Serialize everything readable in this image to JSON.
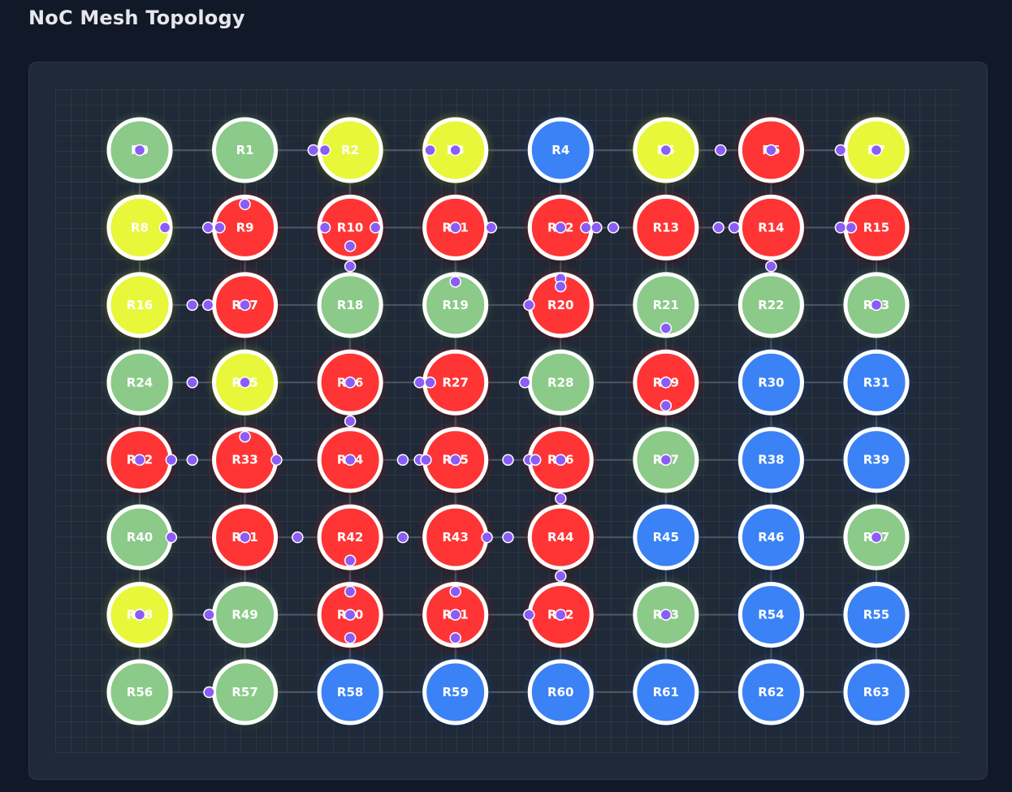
{
  "title": "NoC Mesh Topology",
  "grid": {
    "cols": 8,
    "rows": 8
  },
  "colors": {
    "green": "#8bca88",
    "yellow": "#e9f73a",
    "red": "#ff3434",
    "blue": "#3b82f6",
    "packet": "#8b5cf6",
    "link": "#4b5563",
    "node_border": "#ffffff"
  },
  "nodes": [
    {
      "label": "R0",
      "status": "green"
    },
    {
      "label": "R1",
      "status": "green"
    },
    {
      "label": "R2",
      "status": "yellow"
    },
    {
      "label": "R3",
      "status": "yellow"
    },
    {
      "label": "R4",
      "status": "blue"
    },
    {
      "label": "R5",
      "status": "yellow"
    },
    {
      "label": "R6",
      "status": "red"
    },
    {
      "label": "R7",
      "status": "yellow"
    },
    {
      "label": "R8",
      "status": "yellow"
    },
    {
      "label": "R9",
      "status": "red"
    },
    {
      "label": "R10",
      "status": "red"
    },
    {
      "label": "R11",
      "status": "red"
    },
    {
      "label": "R12",
      "status": "red"
    },
    {
      "label": "R13",
      "status": "red"
    },
    {
      "label": "R14",
      "status": "red"
    },
    {
      "label": "R15",
      "status": "red"
    },
    {
      "label": "R16",
      "status": "yellow"
    },
    {
      "label": "R17",
      "status": "red"
    },
    {
      "label": "R18",
      "status": "green"
    },
    {
      "label": "R19",
      "status": "green"
    },
    {
      "label": "R20",
      "status": "red"
    },
    {
      "label": "R21",
      "status": "green"
    },
    {
      "label": "R22",
      "status": "green"
    },
    {
      "label": "R23",
      "status": "green"
    },
    {
      "label": "R24",
      "status": "green"
    },
    {
      "label": "R25",
      "status": "yellow"
    },
    {
      "label": "R26",
      "status": "red"
    },
    {
      "label": "R27",
      "status": "red"
    },
    {
      "label": "R28",
      "status": "green"
    },
    {
      "label": "R29",
      "status": "red"
    },
    {
      "label": "R30",
      "status": "blue"
    },
    {
      "label": "R31",
      "status": "blue"
    },
    {
      "label": "R32",
      "status": "red"
    },
    {
      "label": "R33",
      "status": "red"
    },
    {
      "label": "R34",
      "status": "red"
    },
    {
      "label": "R35",
      "status": "red"
    },
    {
      "label": "R36",
      "status": "red"
    },
    {
      "label": "R37",
      "status": "green"
    },
    {
      "label": "R38",
      "status": "blue"
    },
    {
      "label": "R39",
      "status": "blue"
    },
    {
      "label": "R40",
      "status": "green"
    },
    {
      "label": "R41",
      "status": "red"
    },
    {
      "label": "R42",
      "status": "red"
    },
    {
      "label": "R43",
      "status": "red"
    },
    {
      "label": "R44",
      "status": "red"
    },
    {
      "label": "R45",
      "status": "blue"
    },
    {
      "label": "R46",
      "status": "blue"
    },
    {
      "label": "R47",
      "status": "green"
    },
    {
      "label": "R48",
      "status": "yellow"
    },
    {
      "label": "R49",
      "status": "green"
    },
    {
      "label": "R50",
      "status": "red"
    },
    {
      "label": "R51",
      "status": "red"
    },
    {
      "label": "R52",
      "status": "red"
    },
    {
      "label": "R53",
      "status": "green"
    },
    {
      "label": "R54",
      "status": "blue"
    },
    {
      "label": "R55",
      "status": "blue"
    },
    {
      "label": "R56",
      "status": "green"
    },
    {
      "label": "R57",
      "status": "green"
    },
    {
      "label": "R58",
      "status": "blue"
    },
    {
      "label": "R59",
      "status": "blue"
    },
    {
      "label": "R60",
      "status": "blue"
    },
    {
      "label": "R61",
      "status": "blue"
    },
    {
      "label": "R62",
      "status": "blue"
    },
    {
      "label": "R63",
      "status": "blue"
    }
  ],
  "packets": [
    {
      "link": "h",
      "row": 0,
      "col": 0,
      "t": 0.0
    },
    {
      "link": "h",
      "row": 0,
      "col": 1,
      "t": 0.65
    },
    {
      "link": "h",
      "row": 0,
      "col": 1,
      "t": 0.76
    },
    {
      "link": "h",
      "row": 0,
      "col": 2,
      "t": 0.76
    },
    {
      "link": "h",
      "row": 0,
      "col": 2,
      "t": 1.0
    },
    {
      "link": "h",
      "row": 0,
      "col": 5,
      "t": 0.0
    },
    {
      "link": "h",
      "row": 0,
      "col": 5,
      "t": 0.52
    },
    {
      "link": "h",
      "row": 0,
      "col": 5,
      "t": 1.0
    },
    {
      "link": "h",
      "row": 0,
      "col": 6,
      "t": 0.66
    },
    {
      "link": "h",
      "row": 0,
      "col": 6,
      "t": 1.0
    },
    {
      "link": "h",
      "row": 1,
      "col": 0,
      "t": 0.24
    },
    {
      "link": "h",
      "row": 1,
      "col": 0,
      "t": 0.65
    },
    {
      "link": "h",
      "row": 1,
      "col": 0,
      "t": 0.76
    },
    {
      "link": "h",
      "row": 1,
      "col": 1,
      "t": 0.76
    },
    {
      "link": "h",
      "row": 1,
      "col": 2,
      "t": 0.24
    },
    {
      "link": "h",
      "row": 1,
      "col": 2,
      "t": 1.0
    },
    {
      "link": "h",
      "row": 1,
      "col": 3,
      "t": 0.34
    },
    {
      "link": "h",
      "row": 1,
      "col": 3,
      "t": 1.0
    },
    {
      "link": "h",
      "row": 1,
      "col": 4,
      "t": 0.24
    },
    {
      "link": "h",
      "row": 1,
      "col": 4,
      "t": 0.34
    },
    {
      "link": "h",
      "row": 1,
      "col": 4,
      "t": 0.5
    },
    {
      "link": "h",
      "row": 1,
      "col": 5,
      "t": 0.5
    },
    {
      "link": "h",
      "row": 1,
      "col": 5,
      "t": 0.65
    },
    {
      "link": "h",
      "row": 1,
      "col": 6,
      "t": 0.66
    },
    {
      "link": "h",
      "row": 1,
      "col": 6,
      "t": 0.76
    },
    {
      "link": "h",
      "row": 2,
      "col": 0,
      "t": 0.5
    },
    {
      "link": "h",
      "row": 2,
      "col": 0,
      "t": 0.65
    },
    {
      "link": "h",
      "row": 2,
      "col": 1,
      "t": 0.0
    },
    {
      "link": "h",
      "row": 2,
      "col": 3,
      "t": 0.7
    },
    {
      "link": "h",
      "row": 2,
      "col": 6,
      "t": 1.0
    },
    {
      "link": "h",
      "row": 3,
      "col": 0,
      "t": 0.5
    },
    {
      "link": "h",
      "row": 3,
      "col": 1,
      "t": 0.0
    },
    {
      "link": "h",
      "row": 3,
      "col": 2,
      "t": 0.0
    },
    {
      "link": "h",
      "row": 3,
      "col": 2,
      "t": 0.66
    },
    {
      "link": "h",
      "row": 3,
      "col": 2,
      "t": 0.76
    },
    {
      "link": "h",
      "row": 3,
      "col": 3,
      "t": 0.66
    },
    {
      "link": "h",
      "row": 3,
      "col": 5,
      "t": 0.0
    },
    {
      "link": "h",
      "row": 4,
      "col": 0,
      "t": 0.0
    },
    {
      "link": "h",
      "row": 4,
      "col": 0,
      "t": 0.3
    },
    {
      "link": "h",
      "row": 4,
      "col": 0,
      "t": 0.5
    },
    {
      "link": "h",
      "row": 4,
      "col": 1,
      "t": 0.3
    },
    {
      "link": "h",
      "row": 4,
      "col": 2,
      "t": 0.0
    },
    {
      "link": "h",
      "row": 4,
      "col": 2,
      "t": 0.5
    },
    {
      "link": "h",
      "row": 4,
      "col": 2,
      "t": 0.66
    },
    {
      "link": "h",
      "row": 4,
      "col": 2,
      "t": 0.72
    },
    {
      "link": "h",
      "row": 4,
      "col": 3,
      "t": 0.0
    },
    {
      "link": "h",
      "row": 4,
      "col": 3,
      "t": 0.5
    },
    {
      "link": "h",
      "row": 4,
      "col": 3,
      "t": 0.7
    },
    {
      "link": "h",
      "row": 4,
      "col": 3,
      "t": 0.76
    },
    {
      "link": "h",
      "row": 4,
      "col": 4,
      "t": 0.0
    },
    {
      "link": "h",
      "row": 4,
      "col": 5,
      "t": 0.0
    },
    {
      "link": "h",
      "row": 5,
      "col": 0,
      "t": 0.3
    },
    {
      "link": "h",
      "row": 5,
      "col": 1,
      "t": 0.0
    },
    {
      "link": "h",
      "row": 5,
      "col": 1,
      "t": 0.5
    },
    {
      "link": "h",
      "row": 5,
      "col": 2,
      "t": 0.5
    },
    {
      "link": "h",
      "row": 5,
      "col": 3,
      "t": 0.3
    },
    {
      "link": "h",
      "row": 5,
      "col": 3,
      "t": 0.5
    },
    {
      "link": "h",
      "row": 5,
      "col": 7,
      "t": 0.0
    },
    {
      "link": "h",
      "row": 6,
      "col": 0,
      "t": 0.0
    },
    {
      "link": "h",
      "row": 6,
      "col": 0,
      "t": 0.66
    },
    {
      "link": "h",
      "row": 6,
      "col": 2,
      "t": 0.0
    },
    {
      "link": "h",
      "row": 6,
      "col": 3,
      "t": 0.0
    },
    {
      "link": "h",
      "row": 6,
      "col": 3,
      "t": 0.7
    },
    {
      "link": "h",
      "row": 6,
      "col": 5,
      "t": 0.0
    },
    {
      "link": "h",
      "row": 7,
      "col": 0,
      "t": 0.66
    },
    {
      "link": "v",
      "row": 0,
      "col": 1,
      "t": 0.7
    },
    {
      "link": "v",
      "row": 1,
      "col": 2,
      "t": 0.24
    },
    {
      "link": "v",
      "row": 1,
      "col": 2,
      "t": 0.5
    },
    {
      "link": "v",
      "row": 1,
      "col": 3,
      "t": 0.7
    },
    {
      "link": "v",
      "row": 1,
      "col": 4,
      "t": 0.66
    },
    {
      "link": "v",
      "row": 1,
      "col": 4,
      "t": 0.76
    },
    {
      "link": "v",
      "row": 1,
      "col": 6,
      "t": 0.5
    },
    {
      "link": "v",
      "row": 2,
      "col": 5,
      "t": 0.3
    },
    {
      "link": "v",
      "row": 3,
      "col": 2,
      "t": 0.5
    },
    {
      "link": "v",
      "row": 3,
      "col": 1,
      "t": 0.7
    },
    {
      "link": "v",
      "row": 3,
      "col": 5,
      "t": 0.3
    },
    {
      "link": "v",
      "row": 4,
      "col": 4,
      "t": 0.5
    },
    {
      "link": "v",
      "row": 5,
      "col": 2,
      "t": 0.3
    },
    {
      "link": "v",
      "row": 5,
      "col": 2,
      "t": 0.7
    },
    {
      "link": "v",
      "row": 5,
      "col": 4,
      "t": 0.5
    },
    {
      "link": "v",
      "row": 5,
      "col": 3,
      "t": 0.7
    },
    {
      "link": "v",
      "row": 6,
      "col": 2,
      "t": 0.3
    },
    {
      "link": "v",
      "row": 6,
      "col": 3,
      "t": 0.3
    },
    {
      "link": "v",
      "row": 6,
      "col": 4,
      "t": 0.0
    }
  ]
}
